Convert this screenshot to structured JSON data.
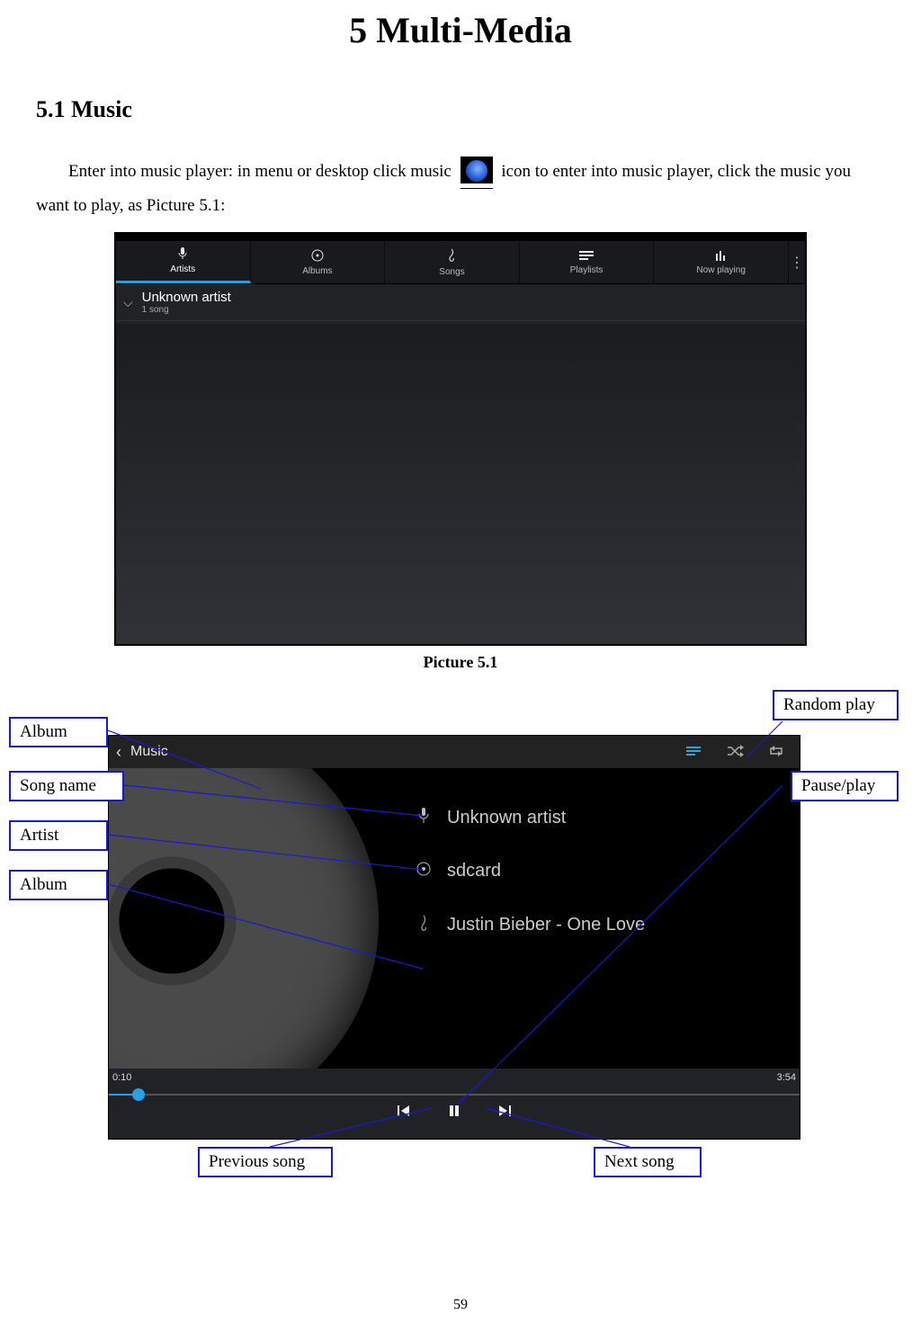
{
  "chapter_title": "5 Multi-Media",
  "section_title": "5.1 Music",
  "paragraph": {
    "part1": "Enter into music player: in menu or desktop click music",
    "part2": "icon to enter into music player, click the music you want to play, as Picture 5.1:"
  },
  "caption1": "Picture 5.1",
  "shot1": {
    "tabs": [
      "Artists",
      "Albums",
      "Songs",
      "Playlists",
      "Now playing"
    ],
    "artist_name": "Unknown artist",
    "artist_sub": "1 song"
  },
  "shot2": {
    "header_title": "Music",
    "artist": "Unknown artist",
    "album": "sdcard",
    "song": "Justin Bieber - One Love",
    "time_elapsed": "0:10",
    "time_total": "3:54"
  },
  "callouts": {
    "album_top": "Album",
    "song_name": "Song name",
    "artist": "Artist",
    "album": "Album",
    "random_play": "Random play",
    "pause_play": "Pause/play",
    "previous_song": "Previous song",
    "next_song": "Next song"
  },
  "page_number": "59"
}
